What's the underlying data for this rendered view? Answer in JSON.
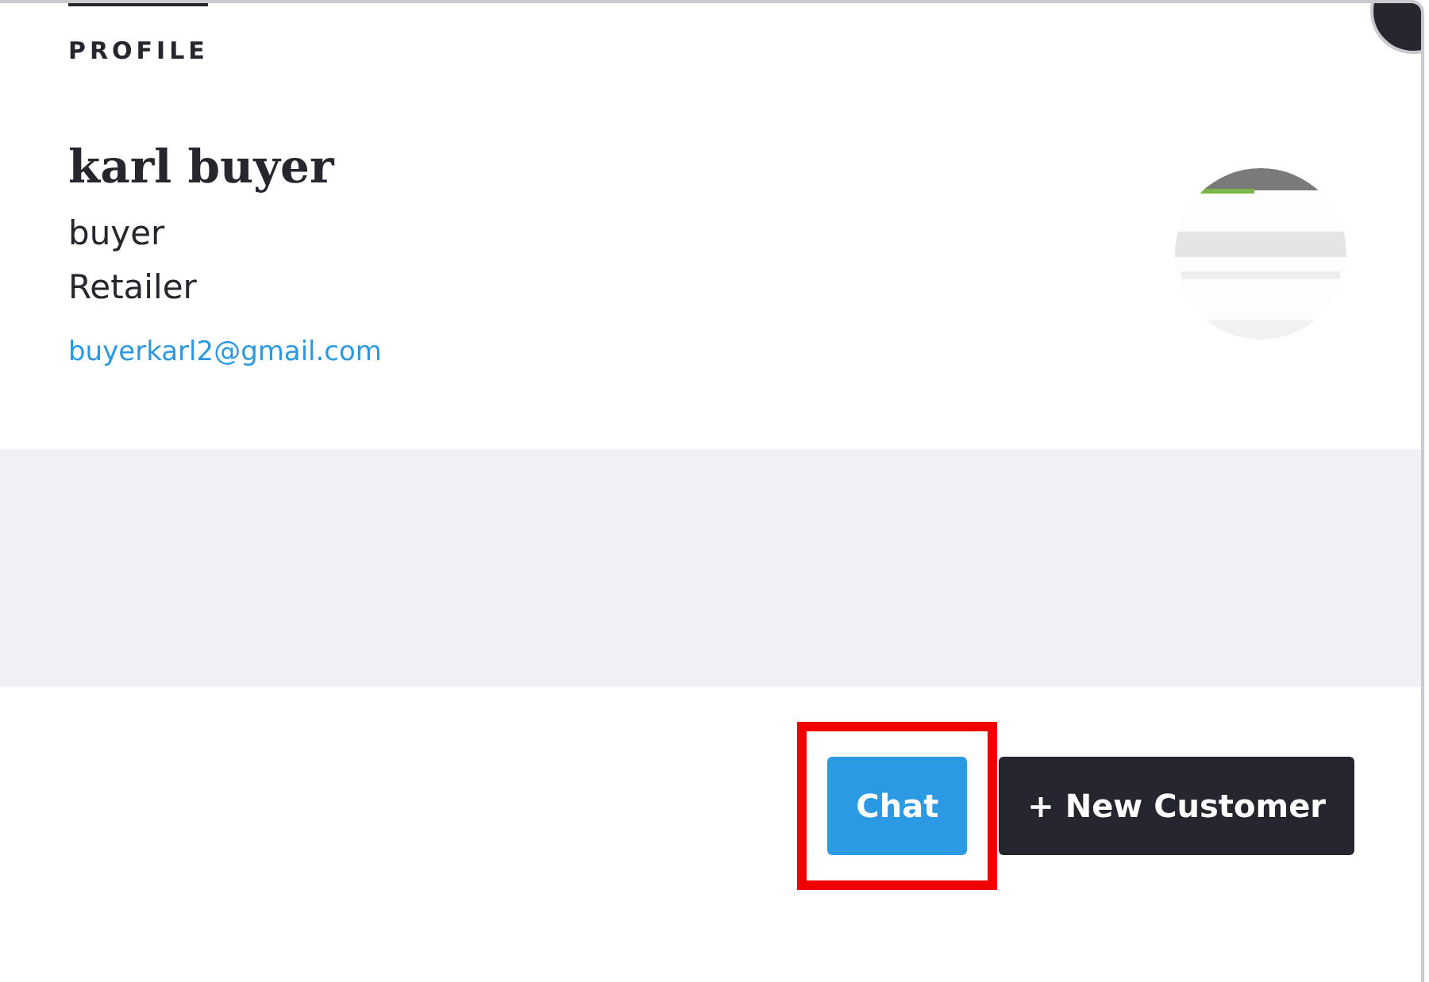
{
  "tabs": [
    {
      "label": "PROFILE",
      "selected": true
    }
  ],
  "profile": {
    "name": "karl buyer",
    "role": "buyer",
    "type": "Retailer",
    "email": "buyerkarl2@gmail.com"
  },
  "buttons": [
    {
      "label": "Chat",
      "kind": "primary",
      "highlighted": true
    },
    {
      "label": "+ New Customer",
      "kind": "dark",
      "highlighted": false
    }
  ]
}
